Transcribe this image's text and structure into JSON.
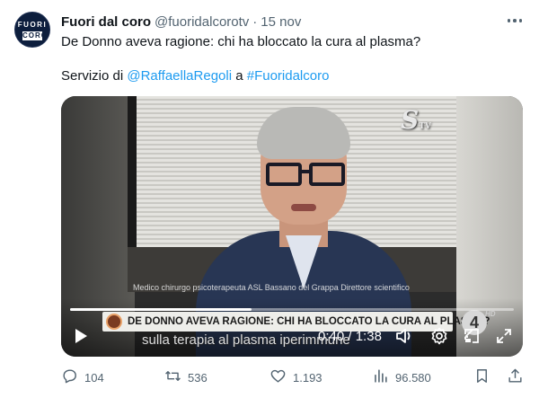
{
  "account": {
    "name": "Fuori dal coro",
    "handle": "@fuoridalcorotv",
    "separator": "·",
    "date": "15 nov",
    "avatar_text_top": "FUORI",
    "avatar_text_bottom": "CORO"
  },
  "tweet": {
    "text": "De Donno aveva ragione: chi ha bloccato la cura al plasma?",
    "credit_prefix": "Servizio di ",
    "mention": "@RaffaellaRegoli",
    "credit_middle": " a ",
    "hashtag": "#Fuoridalcoro"
  },
  "video": {
    "channel_logo": "S",
    "channel_logo_suffix": "TV",
    "caption_strip": "Medico chirurgo psicoterapeuta ASL Bassano del Grappa Direttore scientifico",
    "ticker": "DE DONNO AVEVA RAGIONE: CHI HA BLOCCATO LA CURA AL PLASMA?",
    "sub_banner": "sulla terapia al plasma iperimmune",
    "network_logo": "4",
    "hd_badge": "HD",
    "current_time": "0:40",
    "time_separator": " / ",
    "duration": "1:38",
    "progress_fraction": 0.408
  },
  "actions": {
    "replies": "104",
    "reposts": "536",
    "likes": "1.193",
    "views": "96.580"
  },
  "icons": {
    "more": "more-horizontal-icon",
    "play": "play-icon",
    "volume": "volume-icon",
    "settings": "settings-gear-icon",
    "pip": "picture-in-picture-icon",
    "fullscreen": "fullscreen-icon",
    "reply": "reply-bubble-icon",
    "repost": "repost-icon",
    "like": "heart-icon",
    "views": "views-bar-chart-icon",
    "bookmark": "bookmark-icon",
    "share": "share-icon"
  },
  "colors": {
    "link": "#1d9bf0",
    "secondary_text": "#536471",
    "primary_text": "#0f1419"
  }
}
